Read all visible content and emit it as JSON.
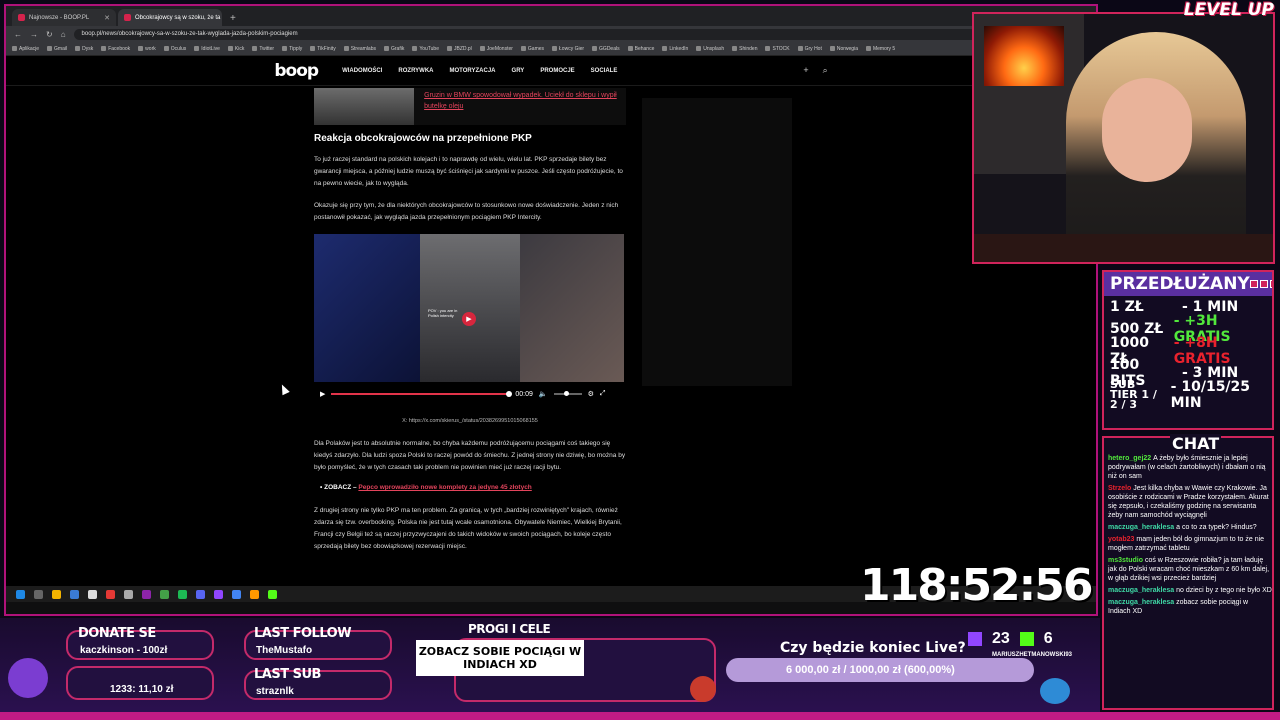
{
  "browser": {
    "tabs": [
      {
        "label": "Najnowsze - BOOP.PL",
        "active": false
      },
      {
        "label": "Obcokrajowcy są w szoku, że ta",
        "active": true
      }
    ],
    "url": "boop.pl/news/obcokrajowcy-sa-w-szoku-ze-tak-wyglada-jazda-polskim-pociagiem",
    "bookmarks": [
      "Aplikacje",
      "Gmail",
      "Dysk",
      "Facebook",
      "work",
      "Oculus",
      "IdiotLive",
      "Kick",
      "Twitter",
      "Tipply",
      "TikFinity",
      "Streamlabs",
      "Grafik",
      "YouTube",
      "JBZD.pl",
      "JoeMonster",
      "Games",
      "Łowcy Gier",
      "GGDeals",
      "Behance",
      "LinkedIn",
      "Unsplash",
      "Shinden",
      "STOCK",
      "Gry Hot",
      "Norwegia",
      "Memory 5"
    ]
  },
  "site": {
    "logo": "boop",
    "nav": [
      "WIADOMOŚCI",
      "ROZRYWKA",
      "MOTORYZACJA",
      "GRY",
      "PROMOCJE",
      "SOCIALE"
    ]
  },
  "article": {
    "related_link": "Gruzin w BMW spowodował wypadek. Uciekł do sklepu i wypił butelkę oleju",
    "heading": "Reakcja obcokrajowców na przepełnione PKP",
    "p1": "To już raczej standard na polskich kolejach i to naprawdę od wielu, wielu lat. PKP sprzedaje bilety bez gwarancji miejsca, a później ludzie muszą być ściśnięci jak sardynki w puszce. Jeśli często podróżujecie, to na pewno wiecie, jak to wygląda.",
    "p2": "Okazuje się przy tym, że dla niektórych obcokrajowców to stosunkowo nowe doświadczenie. Jeden z nich postanowił pokazać, jak wygląda jazda przepełnionym pociągiem PKP Intercity.",
    "video_caption": "POV : you are in Polish intercity",
    "video_time": "00:09",
    "video_progress": 1.0,
    "video_source": "X: https://x.com/skierus_/status/2038269951015068155",
    "p3": "Dla Polaków jest to absolutnie normalne, bo chyba każdemu podróżującemu pociągami coś takiego się kiedyś zdarzyło. Dla ludzi spoza Polski to raczej powód do śmiechu. Z jednej strony nie dziwię, bo można by było pomyśleć, że w tych czasach taki problem nie powinien mieć już raczej racji bytu.",
    "zobacz_label": "ZOBACZ –",
    "zobacz_link": "Pepco wprowadziło nowe komplety za jedyne 45 złotych",
    "p4": "Z drugiej strony nie tylko PKP ma ten problem. Za granicą, w tych „bardziej rozwiniętych\" krajach, również zdarza się tzw. overbooking. Polska nie jest tutaj wcale osamotniona. Obywatele Niemiec, Wielkiej Brytanii, Francji czy Belgii też są raczej przyzwyczajeni do takich widoków w swoich pociągach, bo koleje często sprzedają bilety bez obowiązkowej rezerwacji miejsc."
  },
  "webcam": {
    "logo": "LEVEL UP"
  },
  "pricing": {
    "title": "PRZEDŁUŻANY",
    "rows": [
      {
        "k": "1 ZŁ",
        "v": "- 1 MIN",
        "color": "#ffffff"
      },
      {
        "k": "500 ZŁ",
        "v": "- +3H GRATIS",
        "color": "#52e83c"
      },
      {
        "k": "1000 ZŁ",
        "v": "- +8H GRATIS",
        "color": "#e9222d"
      },
      {
        "k": "100 BITS",
        "v": "- 3 MIN",
        "color": "#ffffff"
      },
      {
        "k": "SUB TIER 1 / 2 / 3",
        "v": "- 10/15/25 MIN",
        "color": "#ffffff"
      }
    ]
  },
  "chat": {
    "title": "CHAT",
    "messages": [
      {
        "user": "hetero_gej22",
        "text": "A żeby było śmiesznie ja lepiej podrywałam (w celach żartobliwych) i dbałam o nią niż on sam",
        "color": "#52e83c"
      },
      {
        "user": "Strzelo",
        "text": "Jest kilka chyba w Wawie czy Krakowie. Ja osobiście z rodzicami w Pradze korzystałem. Akurat się zepsuło, i czekaliśmy godzinę na serwisanta żeby nam samochód wyciągnęli",
        "color": "#e9222d"
      },
      {
        "user": "maczuga_heraklesa",
        "text": "a co to za typek? Hindus?",
        "color": "#3fd9a6"
      },
      {
        "user": "yotab23",
        "text": "mam jeden ból do gimnazjum to to że nie mogłem zatrzymać tabletu",
        "color": "#e9222d"
      },
      {
        "user": "ms3studio",
        "text": "coś w Rzeszowie robiła? ja tam ładuję jak do Polski wracam choć mieszkam z 60 km dalej, w głąb dzikiej wsi przecież bardziej",
        "color": "#52e83c"
      },
      {
        "user": "maczuga_heraklesa",
        "text": "no dzieci by z tego nie było XD",
        "color": "#3fd9a6"
      },
      {
        "user": "maczuga_heraklesa",
        "text": "zobacz sobie pociągi w Indiach XD",
        "color": "#3fd9a6"
      }
    ]
  },
  "overlay": {
    "timer": "118:52:56",
    "donate_label": "DONATE SE",
    "donate_name": "kaczkinson - 100zł",
    "donate_amount": "1233: 11,10 zł",
    "follow_label": "LAST FOLLOW",
    "follow_name": "TheMustafo",
    "sub_label": "LAST SUB",
    "sub_name": "straznlk",
    "progi_label": "PROGI I CELE",
    "message": "ZOBACZ SOBIE POCIĄGI W INDIACH XD",
    "goal_title": "Czy będzie koniec Live?",
    "goal_text": "6 000,00 zł / 1000,00 zł (600,00%)",
    "goal_fraction": 1.0,
    "twitch_count": "23",
    "kick_count": "6",
    "tiktok_user": "MARIUSZHETMANOWSKI93"
  }
}
